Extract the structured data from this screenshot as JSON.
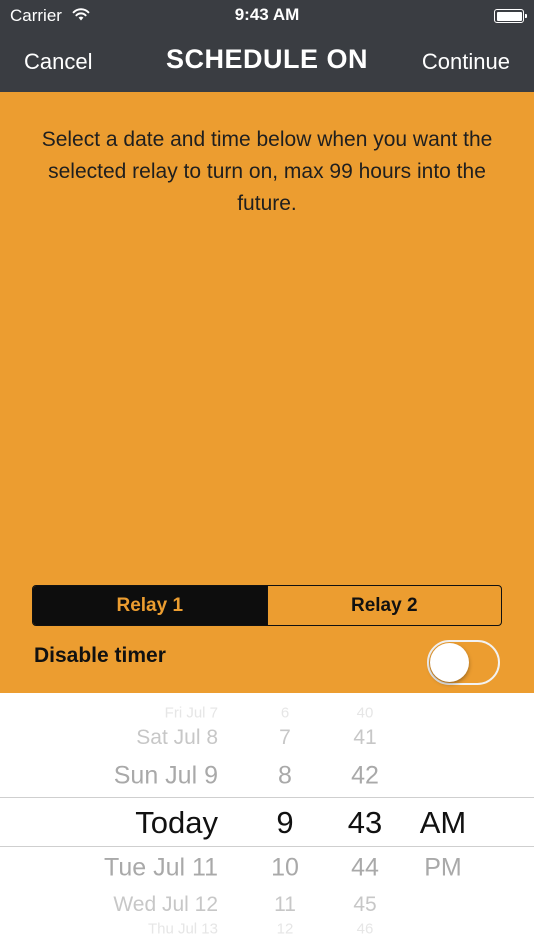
{
  "status": {
    "carrier": "Carrier",
    "time": "9:43 AM"
  },
  "nav": {
    "cancel": "Cancel",
    "title": "SCHEDULE ON",
    "continue": "Continue"
  },
  "instructions": "Select a date and time below when you want the selected relay to turn on, max 99 hours into the future.",
  "segments": {
    "relay1": "Relay 1",
    "relay2": "Relay 2",
    "selected": "Relay 1"
  },
  "disable_timer": {
    "label": "Disable timer",
    "enabled": false
  },
  "picker": {
    "dates": [
      "Fri Jul 7",
      "Sat Jul 8",
      "Sun Jul 9",
      "Today",
      "Tue Jul 11",
      "Wed Jul 12",
      "Thu Jul 13"
    ],
    "hours": [
      "6",
      "7",
      "8",
      "9",
      "10",
      "11",
      "12"
    ],
    "minutes": [
      "40",
      "41",
      "42",
      "43",
      "44",
      "45",
      "46"
    ],
    "ampm": [
      "AM",
      "PM"
    ]
  },
  "colors": {
    "nav": "#3a3d42",
    "orange": "#ec9d30",
    "segment_active": "#0d0d0d"
  }
}
